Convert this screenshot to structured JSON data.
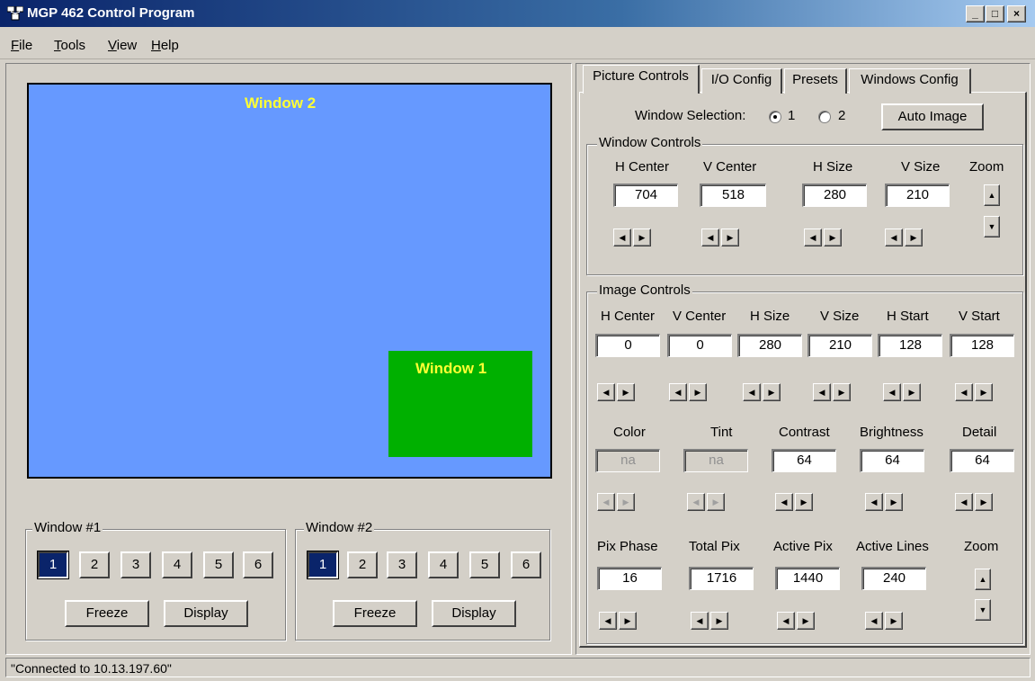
{
  "window": {
    "title": "MGP 462 Control Program",
    "buttons": [
      "_",
      "□",
      "×"
    ]
  },
  "menu": [
    {
      "first": "F",
      "rest": "ile"
    },
    {
      "first": "T",
      "rest": "ools"
    },
    {
      "first": "V",
      "rest": "iew"
    },
    {
      "first": "H",
      "rest": "elp"
    }
  ],
  "preview": {
    "window2_label": "Window 2",
    "window1_label": "Window 1",
    "bg_color": "#6699ff",
    "window1_color": "#00b000",
    "label_color": "#ffff33"
  },
  "window1_group": {
    "title": "Window #1",
    "inputs": [
      "1",
      "2",
      "3",
      "4",
      "5",
      "6"
    ],
    "selected": "1",
    "freeze": "Freeze",
    "display": "Display"
  },
  "window2_group": {
    "title": "Window #2",
    "inputs": [
      "1",
      "2",
      "3",
      "4",
      "5",
      "6"
    ],
    "selected": "1",
    "freeze": "Freeze",
    "display": "Display"
  },
  "tabs": [
    "Picture Controls",
    "I/O Config",
    "Presets",
    "Windows Config"
  ],
  "active_tab": "Picture Controls",
  "window_selection": {
    "label": "Window Selection:",
    "option1": "1",
    "option2": "2",
    "selected": "1",
    "auto_image": "Auto Image"
  },
  "window_controls": {
    "title": "Window Controls",
    "labels": [
      "H Center",
      "V Center",
      "H Size",
      "V Size"
    ],
    "values": [
      "704",
      "518",
      "280",
      "210"
    ],
    "zoom": "Zoom"
  },
  "image_controls": {
    "title": "Image Controls",
    "row1_labels": [
      "H Center",
      "V Center",
      "H Size",
      "V Size",
      "H Start",
      "V Start"
    ],
    "row1_values": [
      "0",
      "0",
      "280",
      "210",
      "128",
      "128"
    ],
    "row2_labels": [
      "Color",
      "Tint",
      "Contrast",
      "Brightness",
      "Detail"
    ],
    "row2_values": [
      "na",
      "na",
      "64",
      "64",
      "64"
    ],
    "row3_labels": [
      "Pix Phase",
      "Total Pix",
      "Active Pix",
      "Active Lines"
    ],
    "row3_values": [
      "16",
      "1716",
      "1440",
      "240"
    ],
    "zoom": "Zoom"
  },
  "status": "\"Connected to 10.13.197.60\""
}
